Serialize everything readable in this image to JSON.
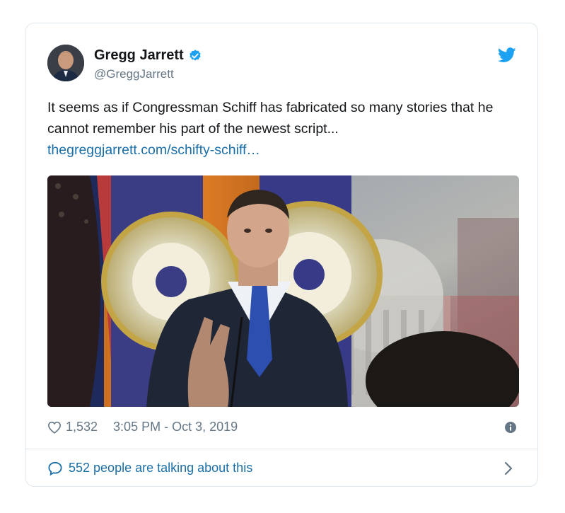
{
  "tweet": {
    "author_name": "Gregg Jarrett",
    "author_handle": "@GreggJarrett",
    "text": "It seems as if Congressman Schiff has fabricated so many stories that he cannot remember his part of the newest script...",
    "link": "thegreggjarrett.com/schifty-schiff…",
    "likes": "1,532",
    "timestamp": "3:05 PM - Oct 3, 2019",
    "conversation_label": "552 people are talking about this"
  },
  "icons": {
    "verified": "verified-badge-icon",
    "brand": "twitter-bird-icon",
    "like": "heart-icon",
    "info": "info-icon",
    "conversation": "speech-bubble-icon",
    "chevron": "chevron-right-icon"
  },
  "colors": {
    "accent": "#1da1f2",
    "link": "#1b6fa8",
    "muted": "#657786"
  }
}
